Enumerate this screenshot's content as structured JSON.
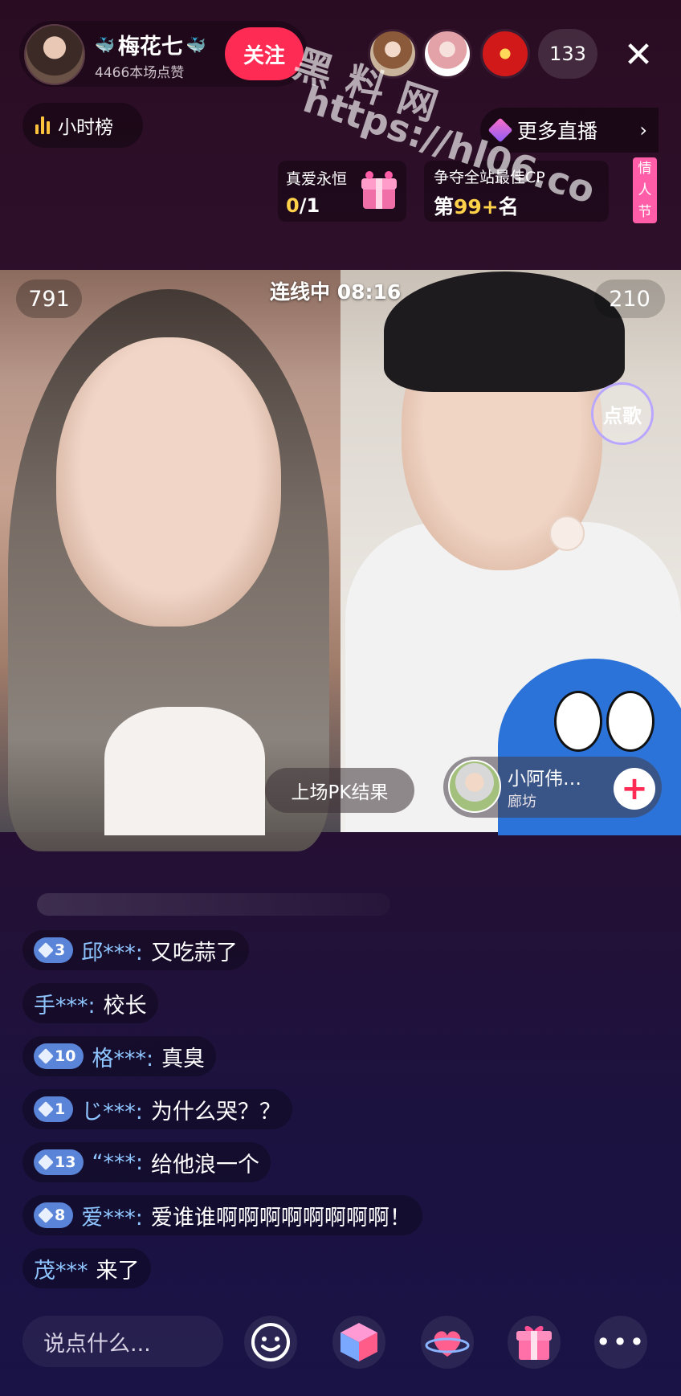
{
  "host": {
    "name": "梅花七",
    "likes": "4466本场点赞",
    "follow_label": "关注"
  },
  "viewers": {
    "count": "133"
  },
  "hour_rank": {
    "label": "小时榜"
  },
  "more_live": {
    "label": "更多直播"
  },
  "love_task": {
    "title": "真爱永恒",
    "progress_current": "0",
    "progress_total": "/1"
  },
  "cp_rank": {
    "title": "争夺全站最佳CP",
    "prefix": "第",
    "rank": "99+",
    "suffix": "名"
  },
  "valentine_tag": "情人节",
  "watermark": {
    "line1": "黑料网",
    "line2": "https://hl06.co"
  },
  "pk": {
    "left_score": "791",
    "right_score": "210",
    "status": "连线中 08:16",
    "song_label": "点歌",
    "result_label": "上场PK结果"
  },
  "guest": {
    "name": "小阿伟…",
    "city": "廊坊"
  },
  "chat": [
    {
      "level": "3",
      "user": "邱***:",
      "text": "又吃蒜了"
    },
    {
      "level": "",
      "user": "手***:",
      "text": "校长"
    },
    {
      "level": "10",
      "user": "格***:",
      "text": "真臭"
    },
    {
      "level": "1",
      "user": "じ***:",
      "text": "为什么哭？？"
    },
    {
      "level": "13",
      "user": "“***:",
      "text": "给他浪一个"
    },
    {
      "level": "8",
      "user": "爱***:",
      "text": "爱谁谁啊啊啊啊啊啊啊啊！"
    },
    {
      "level": "",
      "user": "茂***",
      "text": "来了"
    }
  ],
  "input": {
    "placeholder": "说点什么..."
  },
  "colors": {
    "accent": "#fe2c55",
    "username": "#8ec5ff",
    "gold": "#ffd24a",
    "badge": "#5a84d8"
  }
}
